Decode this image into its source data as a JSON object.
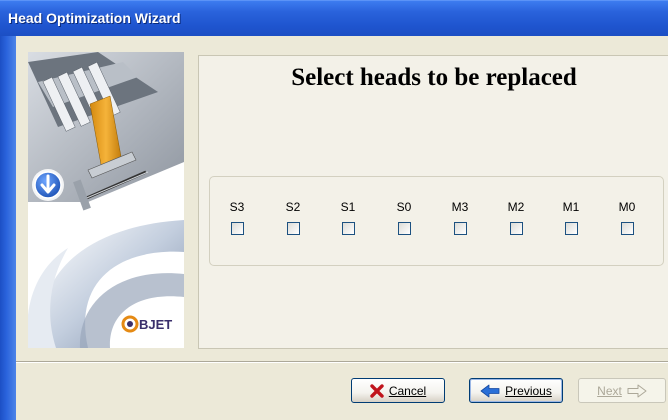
{
  "window": {
    "title": "Head Optimization Wizard"
  },
  "brand": {
    "logo_text": "OBJET"
  },
  "main": {
    "heading": "Select heads to be replaced",
    "heads": [
      {
        "label": "S3",
        "checked": false
      },
      {
        "label": "S2",
        "checked": false
      },
      {
        "label": "S1",
        "checked": false
      },
      {
        "label": "S0",
        "checked": false
      },
      {
        "label": "M3",
        "checked": false
      },
      {
        "label": "M2",
        "checked": false
      },
      {
        "label": "M1",
        "checked": false
      },
      {
        "label": "M0",
        "checked": false
      }
    ]
  },
  "buttons": {
    "cancel": {
      "label": "Cancel",
      "enabled": true
    },
    "previous": {
      "label": "Previous",
      "enabled": true
    },
    "next": {
      "label": "Next",
      "enabled": false
    }
  },
  "colors": {
    "titlebar": "#2a63dc",
    "dialog_bg": "#ece9d8",
    "cancel_icon": "#c0141c",
    "previous_icon": "#2a6fd8",
    "step_icon": "#2d6fd6"
  }
}
